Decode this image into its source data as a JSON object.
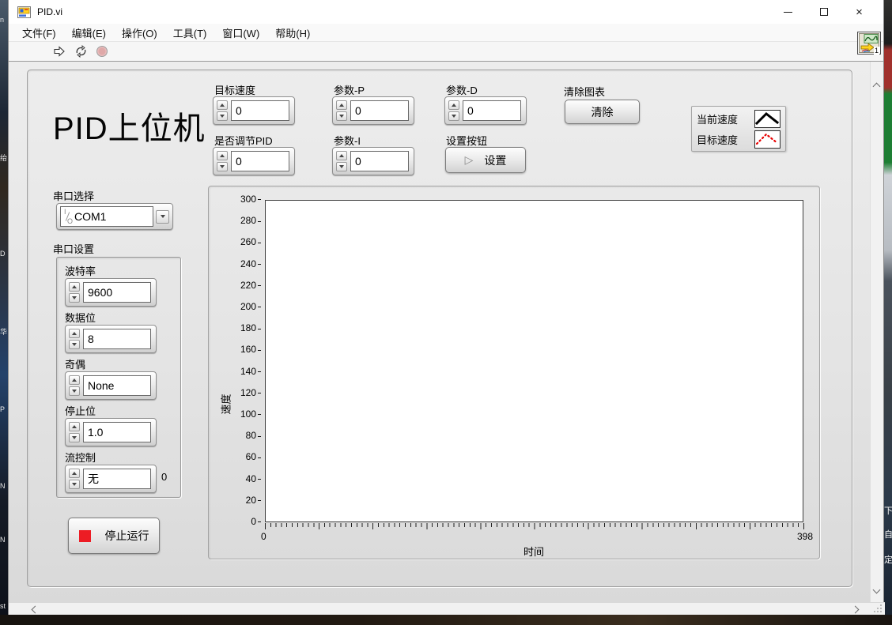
{
  "desktop": {
    "left_fragments": [
      "n",
      "绐",
      "D",
      "华",
      "P",
      "N",
      "N",
      "st"
    ],
    "right_fragments": [
      "下",
      "自",
      "定"
    ]
  },
  "window": {
    "title": "PID.vi",
    "icons": {
      "minimize": "minimize-glyph",
      "maximize": "maximize-glyph",
      "close": "×"
    }
  },
  "menu": {
    "items": [
      "文件(F)",
      "编辑(E)",
      "操作(O)",
      "工具(T)",
      "窗口(W)",
      "帮助(H)"
    ]
  },
  "toolbar": {
    "icons": [
      "run-arrow-icon",
      "run-continuous-icon",
      "abort-stop-icon"
    ],
    "vi_badge": "1"
  },
  "panel": {
    "app_title": "PID上位机",
    "controls": {
      "target_speed": {
        "label": "目标速度",
        "value": "0"
      },
      "param_p": {
        "label": "参数-P",
        "value": "0"
      },
      "param_d": {
        "label": "参数-D",
        "value": "0"
      },
      "pid_enable": {
        "label": "是否调节PID",
        "value": "0"
      },
      "param_i": {
        "label": "参数-I",
        "value": "0"
      }
    },
    "clear_chart": {
      "label": "清除图表",
      "button_label": "清除"
    },
    "setting": {
      "label": "设置按钮",
      "button_label": "设置"
    },
    "serial_select": {
      "label": "串口选择",
      "value": "COM1"
    },
    "serial_settings": {
      "label": "串口设置",
      "baud": {
        "label": "波特率",
        "value": "9600"
      },
      "data_bits": {
        "label": "数据位",
        "value": "8"
      },
      "parity": {
        "label": "奇偶",
        "value": "None"
      },
      "stop_bits": {
        "label": "停止位",
        "value": "1.0"
      },
      "flow": {
        "label": "流控制",
        "value": "无"
      },
      "indicator_value": "0"
    },
    "stop_run": {
      "label": "停止运行",
      "accent_color": "#ed1c24"
    }
  },
  "chart_data": {
    "type": "line",
    "title": "",
    "xlabel": "时间",
    "ylabel": "速度",
    "xlim": [
      0,
      398
    ],
    "ylim": [
      0,
      300
    ],
    "xticks": [
      0,
      398
    ],
    "yticks": [
      0,
      20,
      40,
      60,
      80,
      100,
      120,
      140,
      160,
      180,
      200,
      220,
      240,
      260,
      280,
      300
    ],
    "grid": false,
    "legend_position": "outside-top-right",
    "series": [
      {
        "name": "当前速度",
        "color": "#000000",
        "style": "solid",
        "values": []
      },
      {
        "name": "目标速度",
        "color": "#e80000",
        "style": "dotted",
        "values": []
      }
    ]
  }
}
